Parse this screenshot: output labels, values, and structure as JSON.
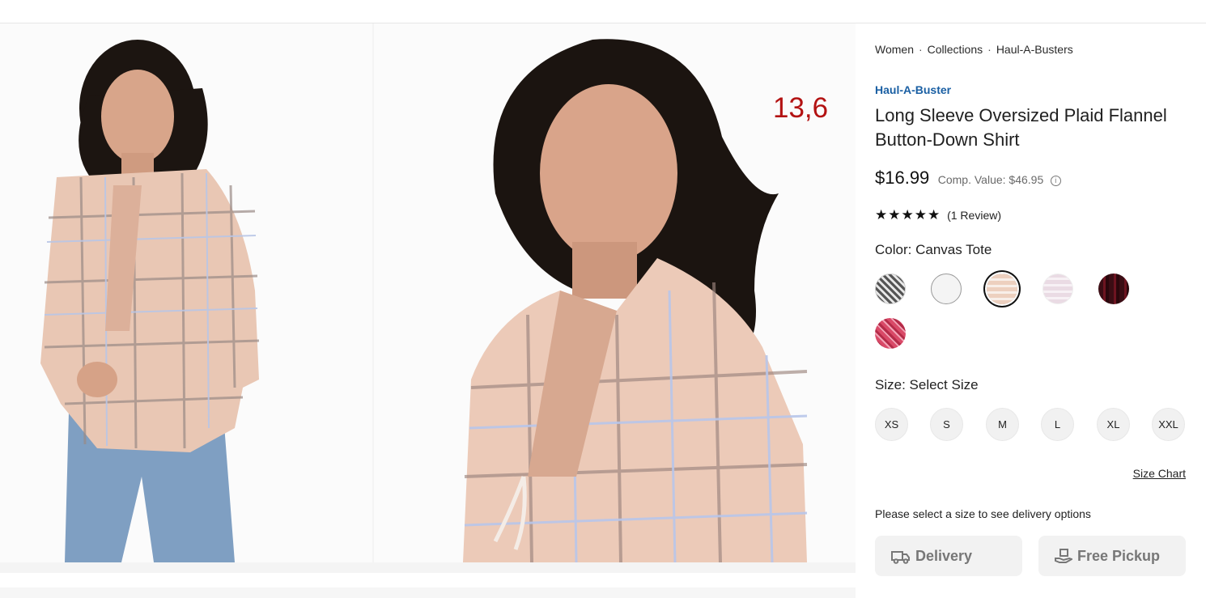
{
  "overlay_text": "13,6",
  "breadcrumb": [
    "Women",
    "Collections",
    "Haul-A-Busters"
  ],
  "breadcrumb_separator": "·",
  "product": {
    "brand": "Haul-A-Buster",
    "title": "Long Sleeve Oversized Plaid Flannel Button-Down Shirt",
    "price": "$16.99",
    "comp_value": "Comp. Value: $46.95",
    "info_icon_glyph": "i",
    "stars": "★★★★★",
    "rating_value": 5,
    "reviews": "(1 Review)"
  },
  "color": {
    "label": "Color:",
    "value": "Canvas Tote",
    "swatches": [
      {
        "name": "gray-plaid",
        "color": "#8c8c8c"
      },
      {
        "name": "white",
        "color": "#f4f4f4"
      },
      {
        "name": "canvas-tote",
        "color": "#e9cfc0",
        "selected": true
      },
      {
        "name": "pink-plaid",
        "color": "#eadbe4"
      },
      {
        "name": "burgundy-plaid",
        "color": "#3b0d14"
      },
      {
        "name": "red-plaid",
        "color": "#d94a68"
      }
    ]
  },
  "size": {
    "label": "Size:",
    "value": "Select Size",
    "options": [
      "XS",
      "S",
      "M",
      "L",
      "XL",
      "XXL"
    ],
    "size_chart": "Size Chart"
  },
  "delivery_message": "Please select a size to see delivery options",
  "fulfillment": {
    "delivery": "Delivery",
    "pickup": "Free Pickup"
  },
  "colors": {
    "brand_blue": "#1a5fa3",
    "overlay_red": "#b31212"
  }
}
